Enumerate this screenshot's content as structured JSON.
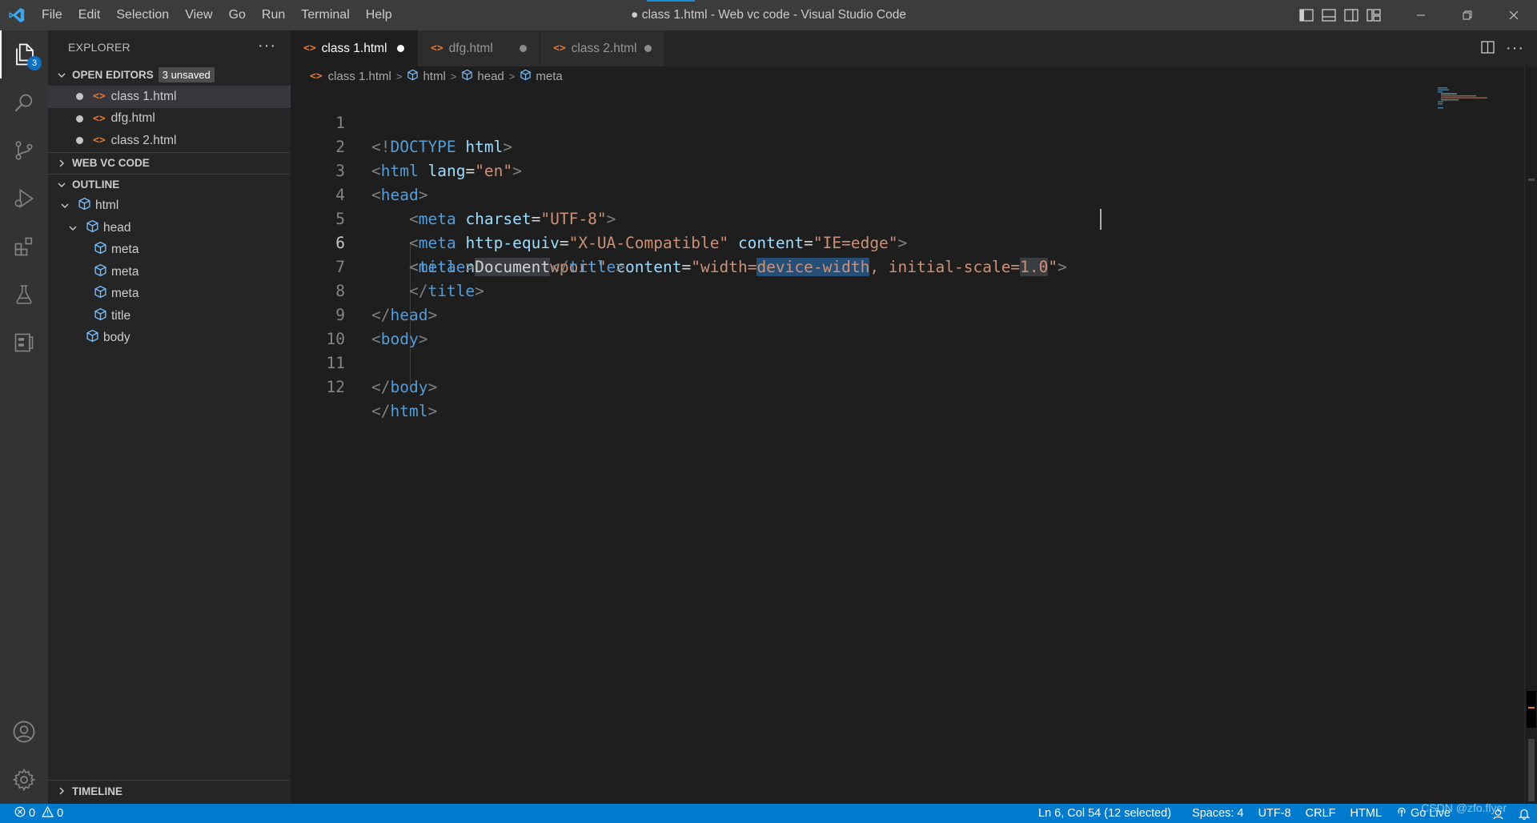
{
  "window": {
    "title": "● class 1.html - Web vc code - Visual Studio Code",
    "menu": [
      "File",
      "Edit",
      "Selection",
      "View",
      "Go",
      "Run",
      "Terminal",
      "Help"
    ]
  },
  "activity_bar": {
    "items": [
      "explorer-icon",
      "search-icon",
      "source-control-icon",
      "run-debug-icon",
      "extensions-icon",
      "testing-icon",
      "remote-explorer-icon"
    ],
    "explorer_badge": "3",
    "bottom": [
      "account-icon",
      "settings-gear-icon"
    ]
  },
  "sidebar": {
    "title": "EXPLORER",
    "more": "···",
    "open_editors": {
      "label": "OPEN EDITORS",
      "badge": "3 unsaved",
      "files": [
        "class 1.html",
        "dfg.html",
        "class 2.html"
      ]
    },
    "workspace": "WEB VC CODE",
    "outline": {
      "label": "OUTLINE",
      "items": [
        "html",
        "head",
        "meta",
        "meta",
        "meta",
        "title",
        "body"
      ]
    },
    "timeline": "TIMELINE"
  },
  "tabs": [
    {
      "label": "class 1.html",
      "active": true,
      "dirty": true
    },
    {
      "label": "dfg.html",
      "active": false,
      "dirty": true
    },
    {
      "label": "class 2.html",
      "active": false,
      "dirty": true
    }
  ],
  "breadcrumb": [
    "class 1.html",
    "html",
    "head",
    "meta"
  ],
  "editor": {
    "line_numbers": [
      "1",
      "2",
      "3",
      "4",
      "5",
      "6",
      "7",
      "8",
      "9",
      "10",
      "11",
      "12"
    ],
    "current_line": "6"
  },
  "status": {
    "errors": "0",
    "warnings": "0",
    "position": "Ln 6, Col 54 (12 selected)",
    "spaces": "Spaces: 4",
    "encoding": "UTF-8",
    "eol": "CRLF",
    "language": "HTML",
    "go_live": "Go Live",
    "watermark": "CSDN @zfo.flyer"
  },
  "colors": {
    "accent": "#007acc",
    "tag": "#569cd6",
    "attribute": "#9cdcfe",
    "string": "#ce9178",
    "html_file_icon": "#e37933",
    "outline_icon": "#75beff"
  }
}
